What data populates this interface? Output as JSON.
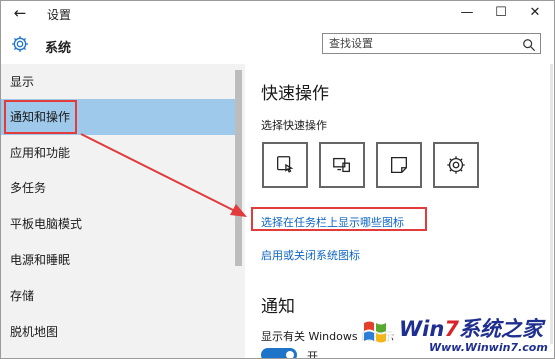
{
  "window": {
    "back_glyph": "←",
    "title": "设置",
    "minimize_glyph": "—",
    "maximize_glyph": "☐",
    "close_glyph": "✕"
  },
  "header": {
    "icon": "gear-icon",
    "title": "系统",
    "search_placeholder": "查找设置",
    "search_icon": "search-icon"
  },
  "sidebar": {
    "items": [
      {
        "label": "显示",
        "active": false
      },
      {
        "label": "通知和操作",
        "active": true
      },
      {
        "label": "应用和功能",
        "active": false
      },
      {
        "label": "多任务",
        "active": false
      },
      {
        "label": "平板电脑模式",
        "active": false
      },
      {
        "label": "电源和睡眠",
        "active": false
      },
      {
        "label": "存储",
        "active": false
      },
      {
        "label": "脱机地图",
        "active": false
      }
    ]
  },
  "quick_actions": {
    "title": "快速操作",
    "subtitle": "选择快速操作",
    "tiles": [
      "tablet-mode-icon",
      "project-icon",
      "note-icon",
      "settings-gear-icon"
    ]
  },
  "links": {
    "taskbar_icons": "选择在任务栏上显示哪些图标",
    "system_icons": "启用或关闭系统图标"
  },
  "notifications": {
    "title": "通知",
    "subtitle": "显示有关 Windows 的提示",
    "toggle_label": "开",
    "toggle_on": true
  },
  "colors": {
    "accent": "#1e74c8",
    "sidebar_active": "#9fc9ea",
    "annotation_red": "#e23b3b",
    "link": "#0e66c4"
  },
  "watermark": {
    "brand_prefix": "Win",
    "brand_seven": "7",
    "brand_suffix": "系统之家",
    "url": "Www.Winwin7.com"
  }
}
